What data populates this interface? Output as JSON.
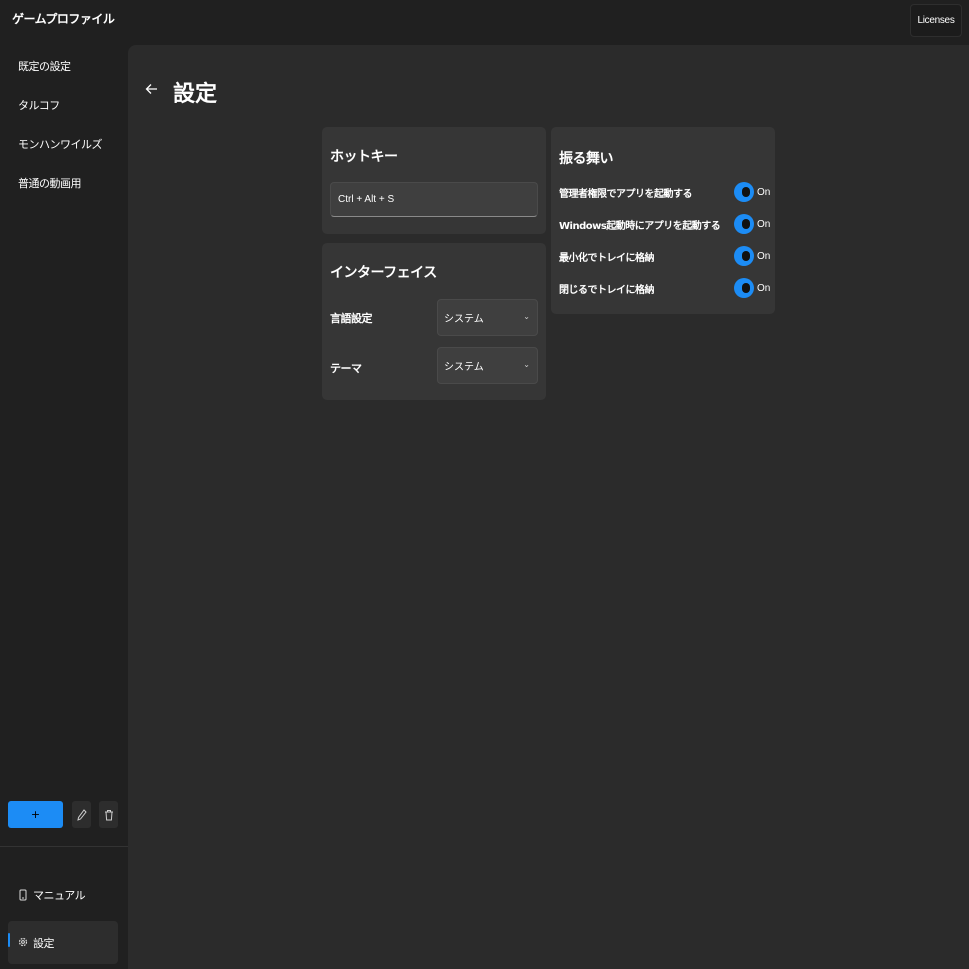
{
  "app": {
    "title": "ゲームプロファイル"
  },
  "header": {
    "licenses_label": "Licenses"
  },
  "sidebar": {
    "profiles": [
      {
        "label": "既定の設定"
      },
      {
        "label": "タルコフ"
      },
      {
        "label": "モンハンワイルズ"
      },
      {
        "label": "普通の動画用"
      }
    ],
    "add_label": "+",
    "footer": [
      {
        "label": "マニュアル",
        "icon": "phone-icon"
      },
      {
        "label": "設定",
        "icon": "gear-icon",
        "selected": true
      }
    ]
  },
  "page": {
    "title": "設定"
  },
  "hotkey": {
    "title": "ホットキー",
    "value": "Ctrl + Alt + S"
  },
  "interface": {
    "title": "インターフェイス",
    "language": {
      "label": "言語設定",
      "value": "システム"
    },
    "theme": {
      "label": "テーマ",
      "value": "システム"
    }
  },
  "behavior": {
    "title": "振る舞い",
    "items": [
      {
        "label": "管理者権限でアプリを起動する",
        "state": "On"
      },
      {
        "label": "Windows起動時にアプリを起動する",
        "state": "On"
      },
      {
        "label": "最小化でトレイに格納",
        "state": "On"
      },
      {
        "label": "閉じるでトレイに格納",
        "state": "On"
      }
    ]
  },
  "colors": {
    "accent": "#1c8cf5",
    "background": "#202020",
    "pane": "#2b2b2b",
    "card": "#363636"
  }
}
